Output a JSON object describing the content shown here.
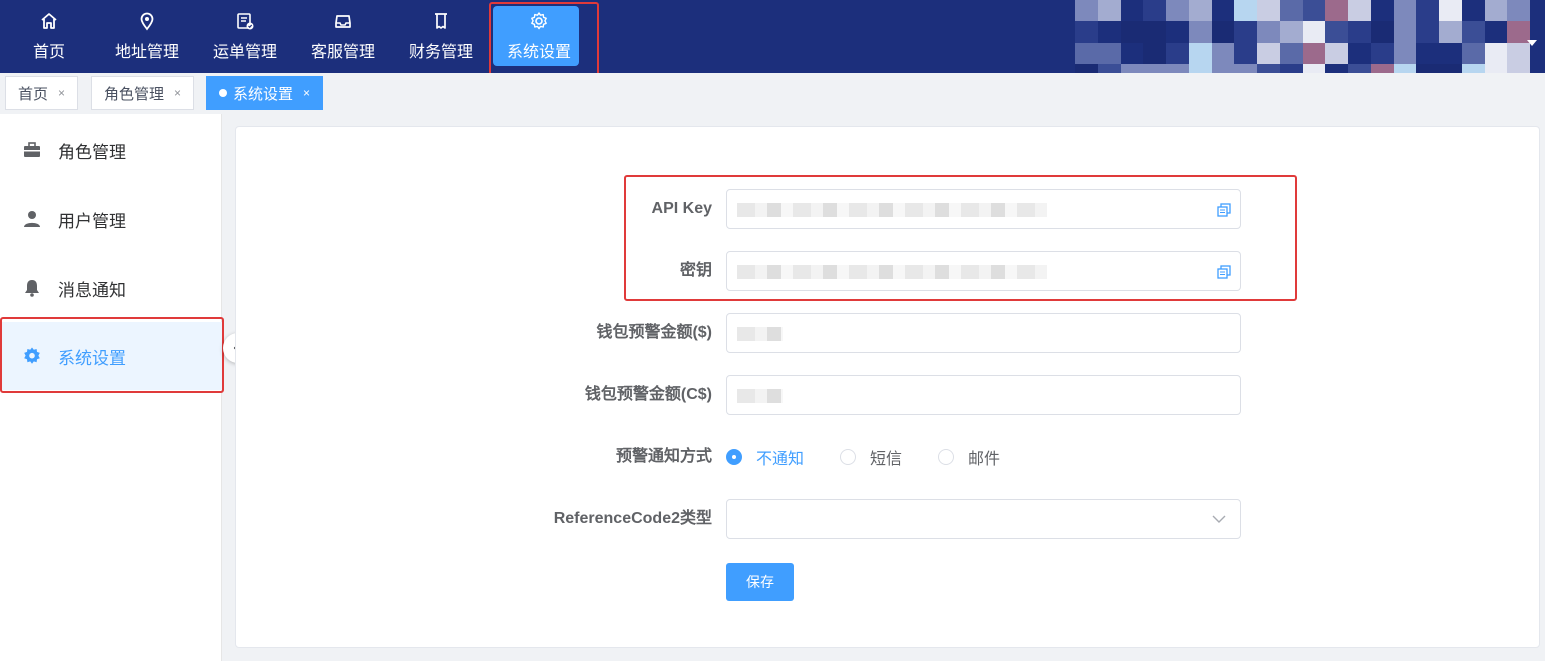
{
  "topnav": {
    "items": [
      {
        "label": "首页",
        "icon": "home-icon"
      },
      {
        "label": "地址管理",
        "icon": "location-pin-icon"
      },
      {
        "label": "运单管理",
        "icon": "waybill-icon"
      },
      {
        "label": "客服管理",
        "icon": "inbox-icon"
      },
      {
        "label": "财务管理",
        "icon": "receipt-icon"
      },
      {
        "label": "系统设置",
        "icon": "gear-icon",
        "active": true
      }
    ]
  },
  "tabs": [
    {
      "label": "首页",
      "close": "×"
    },
    {
      "label": "角色管理",
      "close": "×"
    },
    {
      "label": "系统设置",
      "close": "×",
      "active": true
    }
  ],
  "sidebar": {
    "items": [
      {
        "label": "角色管理",
        "icon": "briefcase-icon"
      },
      {
        "label": "用户管理",
        "icon": "user-icon"
      },
      {
        "label": "消息通知",
        "icon": "bell-icon"
      },
      {
        "label": "系统设置",
        "icon": "gear-icon",
        "active": true
      }
    ]
  },
  "form": {
    "api_key_label": "API Key",
    "secret_label": "密钥",
    "wallet_usd_label": "钱包预警金额($)",
    "wallet_cad_label": "钱包预警金额(C$)",
    "notify_label": "预警通知方式",
    "notify_options": [
      "不通知",
      "短信",
      "邮件"
    ],
    "notify_selected": "不通知",
    "refcode_label": "ReferenceCode2类型",
    "refcode_value": "",
    "save_label": "保存"
  },
  "colors": {
    "header_bg": "#1c2f7c",
    "accent": "#409eff",
    "highlight": "#e03a3a"
  }
}
